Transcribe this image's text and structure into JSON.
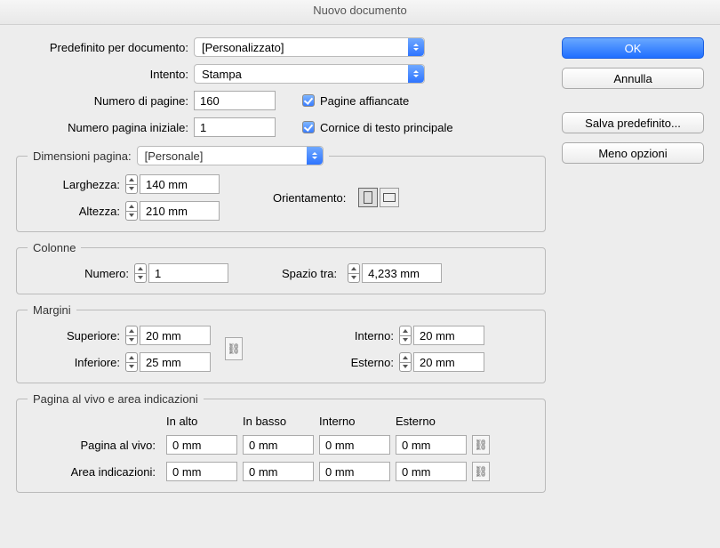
{
  "title": "Nuovo documento",
  "labels": {
    "preset": "Predefinito per documento:",
    "intent": "Intento:",
    "numPages": "Numero di pagine:",
    "startPage": "Numero pagina iniziale:",
    "facingPages": "Pagine affiancate",
    "primaryFrame": "Cornice di testo principale",
    "pageSize": "Dimensioni pagina:",
    "width": "Larghezza:",
    "height": "Altezza:",
    "orientation": "Orientamento:",
    "columnsLegend": "Colonne",
    "colNumber": "Numero:",
    "gutter": "Spazio tra:",
    "marginsLegend": "Margini",
    "top": "Superiore:",
    "bottom": "Inferiore:",
    "inside": "Interno:",
    "outside": "Esterno:",
    "bleedLegend": "Pagina al vivo e area indicazioni",
    "colTop": "In alto",
    "colBottom": "In basso",
    "colInside": "Interno",
    "colOutside": "Esterno",
    "bleedRow": "Pagina al vivo:",
    "slugRow": "Area indicazioni:"
  },
  "values": {
    "preset": "[Personalizzato]",
    "intent": "Stampa",
    "numPages": "160",
    "startPage": "1",
    "facingPagesChecked": true,
    "primaryFrameChecked": true,
    "pageSize": "[Personale]",
    "width": "140 mm",
    "height": "210 mm",
    "colNumber": "1",
    "gutter": "4,233 mm",
    "marginTop": "20 mm",
    "marginBottom": "25 mm",
    "marginInside": "20 mm",
    "marginOutside": "20 mm",
    "bleed": {
      "top": "0 mm",
      "bottom": "0 mm",
      "inside": "0 mm",
      "outside": "0 mm"
    },
    "slug": {
      "top": "0 mm",
      "bottom": "0 mm",
      "inside": "0 mm",
      "outside": "0 mm"
    }
  },
  "buttons": {
    "ok": "OK",
    "cancel": "Annulla",
    "savePreset": "Salva predefinito...",
    "fewerOptions": "Meno opzioni"
  }
}
